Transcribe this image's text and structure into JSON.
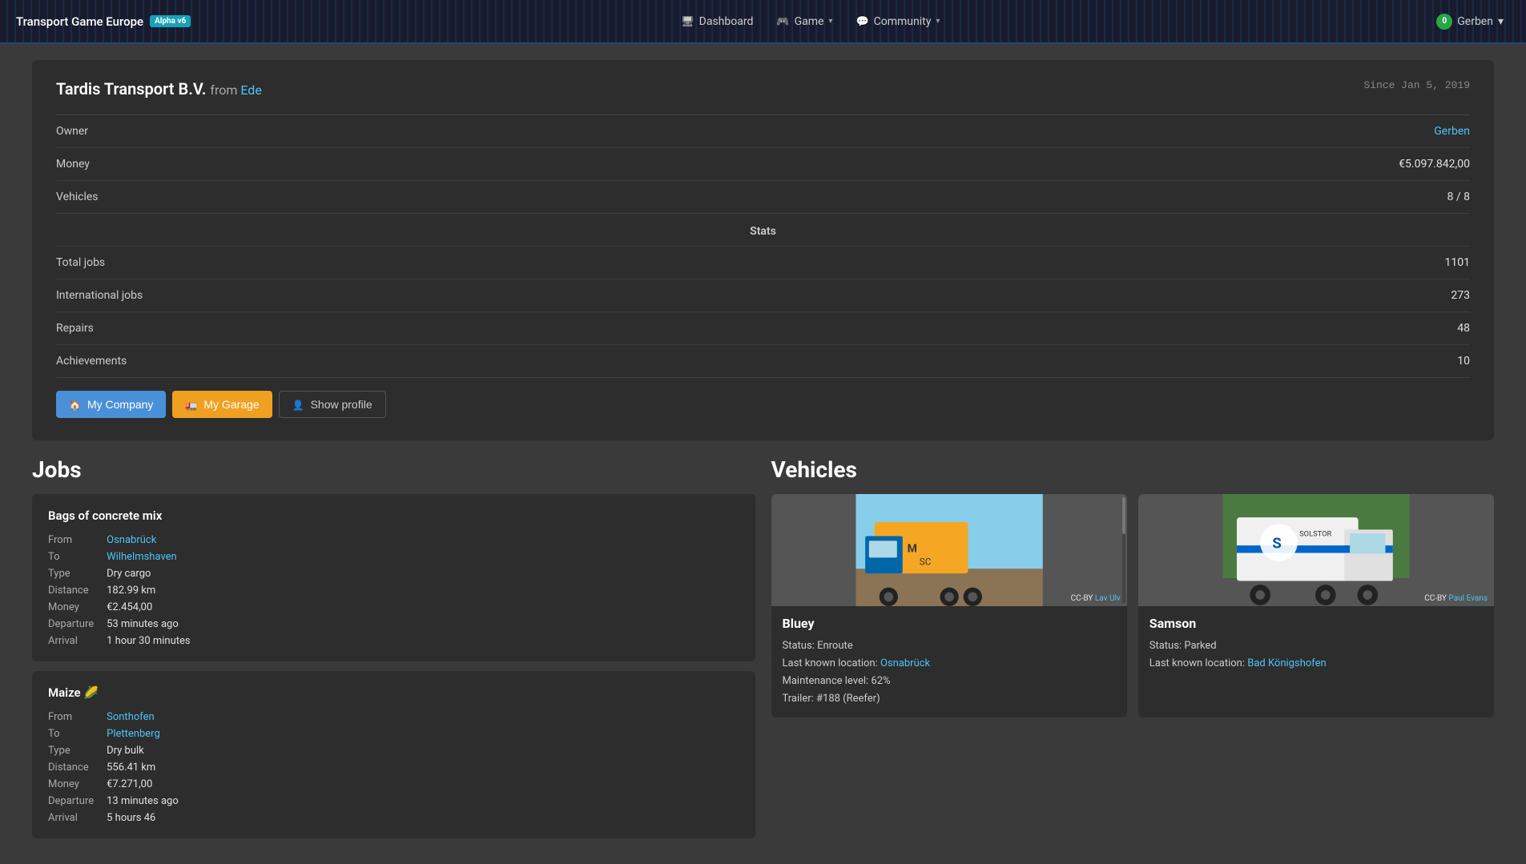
{
  "nav": {
    "brand": "Transport Game Europe",
    "alpha_badge": "Alpha v6",
    "dashboard_label": "Dashboard",
    "game_label": "Game",
    "community_label": "Community",
    "user_label": "Gerben",
    "user_online_count": "0"
  },
  "company": {
    "name": "Tardis Transport B.V.",
    "from_text": "from",
    "location": "Ede",
    "since": "Since Jan 5, 2019",
    "owner_label": "Owner",
    "owner_value": "Gerben",
    "money_label": "Money",
    "money_value": "€5.097.842,00",
    "vehicles_label": "Vehicles",
    "vehicles_value": "8 / 8",
    "stats_header": "Stats",
    "total_jobs_label": "Total jobs",
    "total_jobs_value": "1101",
    "international_jobs_label": "International jobs",
    "international_jobs_value": "273",
    "repairs_label": "Repairs",
    "repairs_value": "48",
    "achievements_label": "Achievements",
    "achievements_value": "10"
  },
  "buttons": {
    "my_company": "My Company",
    "my_garage": "My Garage",
    "show_profile": "Show profile"
  },
  "jobs_section": {
    "title": "Jobs",
    "cards": [
      {
        "title": "Bags of concrete mix",
        "from_label": "From",
        "from_value": "Osnabrück",
        "to_label": "To",
        "to_value": "Wilhelmshaven",
        "type_label": "Type",
        "type_value": "Dry cargo",
        "distance_label": "Distance",
        "distance_value": "182.99 km",
        "money_label": "Money",
        "money_value": "€2.454,00",
        "departure_label": "Departure",
        "departure_value": "53 minutes ago",
        "arrival_label": "Arrival",
        "arrival_value": "1 hour 30 minutes"
      },
      {
        "title": "Maize 🌽",
        "from_label": "From",
        "from_value": "Sonthofen",
        "to_label": "To",
        "to_value": "Plettenberg",
        "type_label": "Type",
        "type_value": "Dry bulk",
        "distance_label": "Distance",
        "distance_value": "556.41 km",
        "money_label": "Money",
        "money_value": "€7.271,00",
        "departure_label": "Departure",
        "departure_value": "13 minutes ago",
        "arrival_label": "Arrival",
        "arrival_value": "5 hours 46"
      }
    ]
  },
  "vehicles_section": {
    "title": "Vehicles",
    "cards": [
      {
        "name": "Bluey",
        "cc_label": "CC-BY",
        "cc_author": "Lav Ulv",
        "status_label": "Status:",
        "status_value": "Enroute",
        "location_label": "Last known location:",
        "location_value": "Osnabrück",
        "maintenance_label": "Maintenance level:",
        "maintenance_value": "62%",
        "trailer_label": "Trailer:",
        "trailer_value": "#188 (Reefer)"
      },
      {
        "name": "Samson",
        "cc_label": "CC-BY",
        "cc_author": "Paul Evans",
        "status_label": "Status:",
        "status_value": "Parked",
        "location_label": "Last known location:",
        "location_value": "Bad Königshofen"
      }
    ]
  }
}
